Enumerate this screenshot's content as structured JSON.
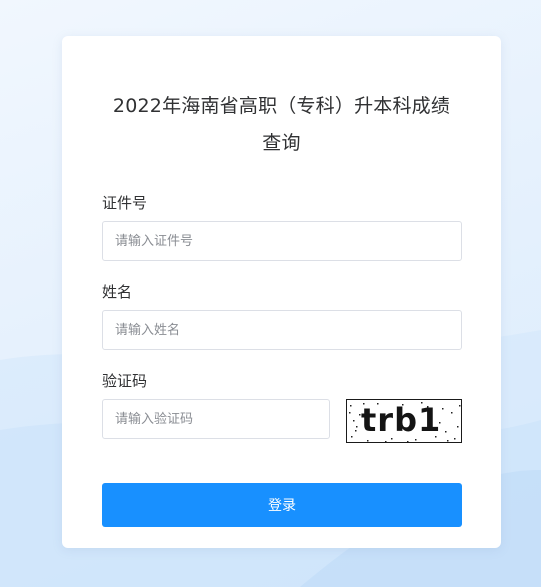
{
  "form": {
    "title_line1": "2022年海南省高职（专科）升本科成绩",
    "title_line2": "查询",
    "id_label": "证件号",
    "id_placeholder": "请输入证件号",
    "name_label": "姓名",
    "name_placeholder": "请输入姓名",
    "code_label": "验证码",
    "code_placeholder": "请输入验证码",
    "captcha_text": "trb1",
    "submit_label": "登录"
  },
  "colors": {
    "primary": "#1890ff",
    "background": "#e6f1fd",
    "card": "#ffffff",
    "text": "#303133",
    "border": "#dcdfe6"
  }
}
